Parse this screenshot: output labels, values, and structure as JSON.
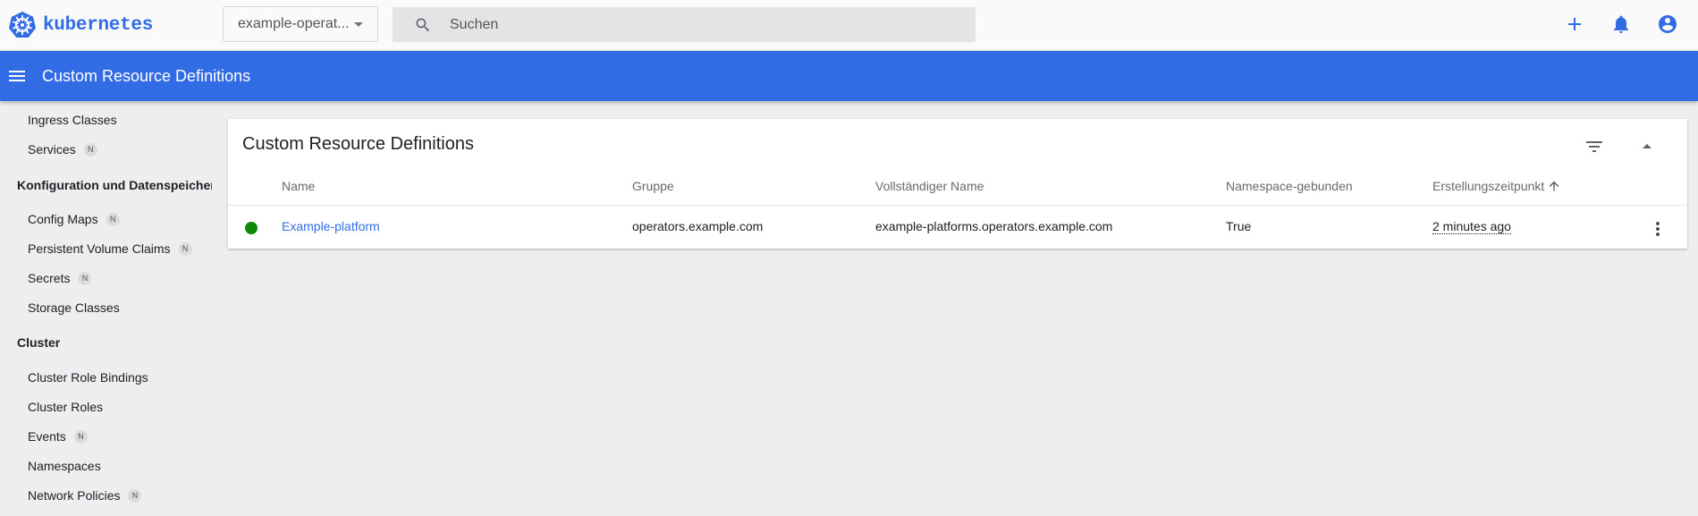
{
  "app": {
    "brand": "kubernetes",
    "namespace_selected": "example-operat...",
    "search_placeholder": "Suchen",
    "page_title": "Custom Resource Definitions",
    "colors": {
      "primary": "#326ce5",
      "status_ok": "#0b8a0b"
    }
  },
  "icons": {
    "logo": "kubernetes-helm-icon",
    "search": "search-icon",
    "create": "plus-icon",
    "notifications": "bell-icon",
    "account": "account-circle-icon",
    "menu": "hamburger-menu-icon",
    "filter": "filter-icon",
    "collapse": "caret-up-icon",
    "sort": "arrow-up-icon",
    "row_actions": "more-vert-icon"
  },
  "sidebar": {
    "items_top": [
      {
        "label": "Ingress Classes",
        "badge": ""
      },
      {
        "label": "Services",
        "badge": "N"
      }
    ],
    "config_header": "Konfiguration und Datenspeicheru",
    "config_items": [
      {
        "label": "Config Maps",
        "badge": "N"
      },
      {
        "label": "Persistent Volume Claims",
        "badge": "N"
      },
      {
        "label": "Secrets",
        "badge": "N"
      },
      {
        "label": "Storage Classes",
        "badge": ""
      }
    ],
    "cluster_header": "Cluster",
    "cluster_items": [
      {
        "label": "Cluster Role Bindings",
        "badge": ""
      },
      {
        "label": "Cluster Roles",
        "badge": ""
      },
      {
        "label": "Events",
        "badge": "N"
      },
      {
        "label": "Namespaces",
        "badge": ""
      },
      {
        "label": "Network Policies",
        "badge": "N"
      }
    ]
  },
  "card": {
    "title": "Custom Resource Definitions",
    "columns": [
      "Name",
      "Gruppe",
      "Vollständiger Name",
      "Namespace-gebunden",
      "Erstellungszeitpunkt"
    ],
    "rows": [
      {
        "status": "ok",
        "name": "Example-platform",
        "group": "operators.example.com",
        "full_name": "example-platforms.operators.example.com",
        "namespaced": "True",
        "created": "2 minutes ago"
      }
    ]
  }
}
